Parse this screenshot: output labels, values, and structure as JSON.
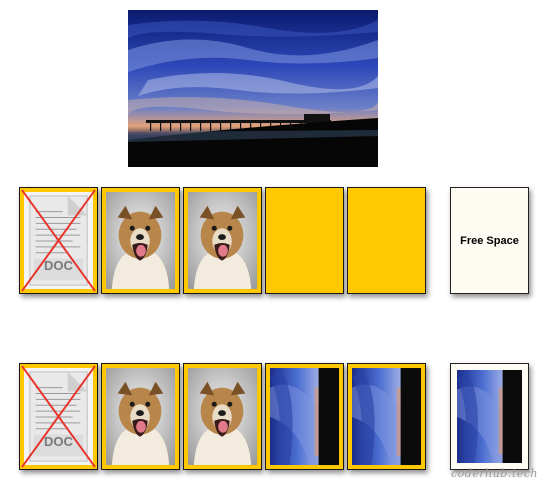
{
  "hero": {
    "image": "sky-pier-photo"
  },
  "rows": [
    {
      "slots": [
        {
          "kind": "doc-excluded",
          "badge": "DOC"
        },
        {
          "kind": "dog-photo"
        },
        {
          "kind": "dog-photo"
        },
        {
          "kind": "empty"
        },
        {
          "kind": "empty"
        }
      ],
      "free_slot": {
        "label": "Free Space"
      }
    },
    {
      "slots": [
        {
          "kind": "doc-excluded",
          "badge": "DOC"
        },
        {
          "kind": "dog-photo"
        },
        {
          "kind": "dog-photo"
        },
        {
          "kind": "sky-photo"
        },
        {
          "kind": "sky-photo"
        }
      ],
      "free_slot": {
        "kind": "sky-photo"
      }
    }
  ],
  "watermark": "coderhub.tech",
  "colors": {
    "slot_yellow": "#ffc800",
    "exclude_x": "#e8322b",
    "free_bg": "#fdfbf2"
  }
}
